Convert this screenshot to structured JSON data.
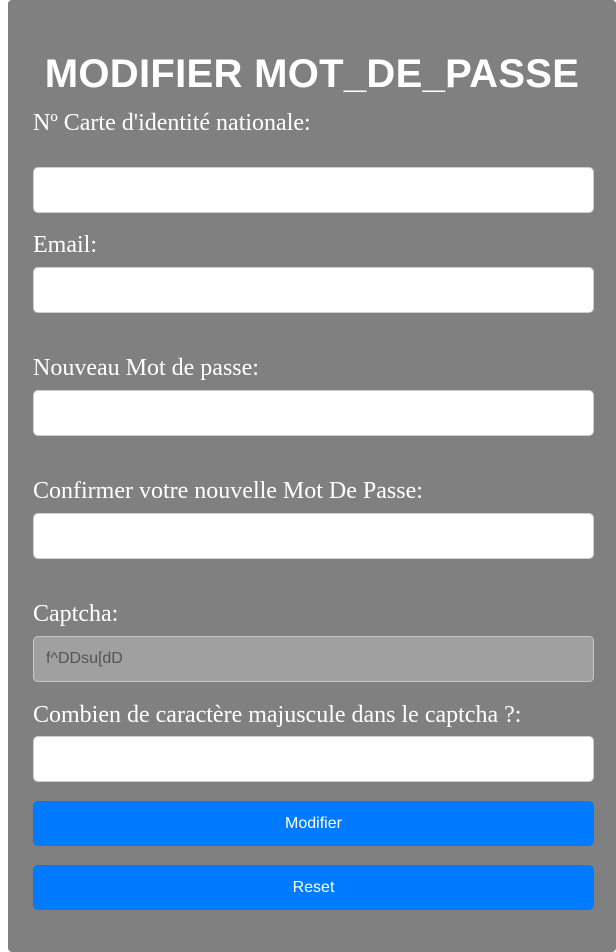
{
  "form": {
    "title": "MODIFIER MOT_DE_PASSE",
    "cin_label": "Nº Carte d'identité nationale:",
    "cin_value": "",
    "email_label": "Email:",
    "email_value": "",
    "new_password_label": "Nouveau Mot de passe:",
    "new_password_value": "",
    "confirm_password_label": "Confirmer votre nouvelle Mot De Passe:",
    "confirm_password_value": "",
    "captcha_label": "Captcha:",
    "captcha_value": "f^DDsu[dD",
    "uppercase_question_label": "Combien de caractère majuscule dans le captcha ?:",
    "uppercase_answer_value": "",
    "submit_label": "Modifier",
    "reset_label": "Reset"
  },
  "colors": {
    "panel_background": "#808080",
    "button_background": "#007bff",
    "text": "#ffffff"
  }
}
